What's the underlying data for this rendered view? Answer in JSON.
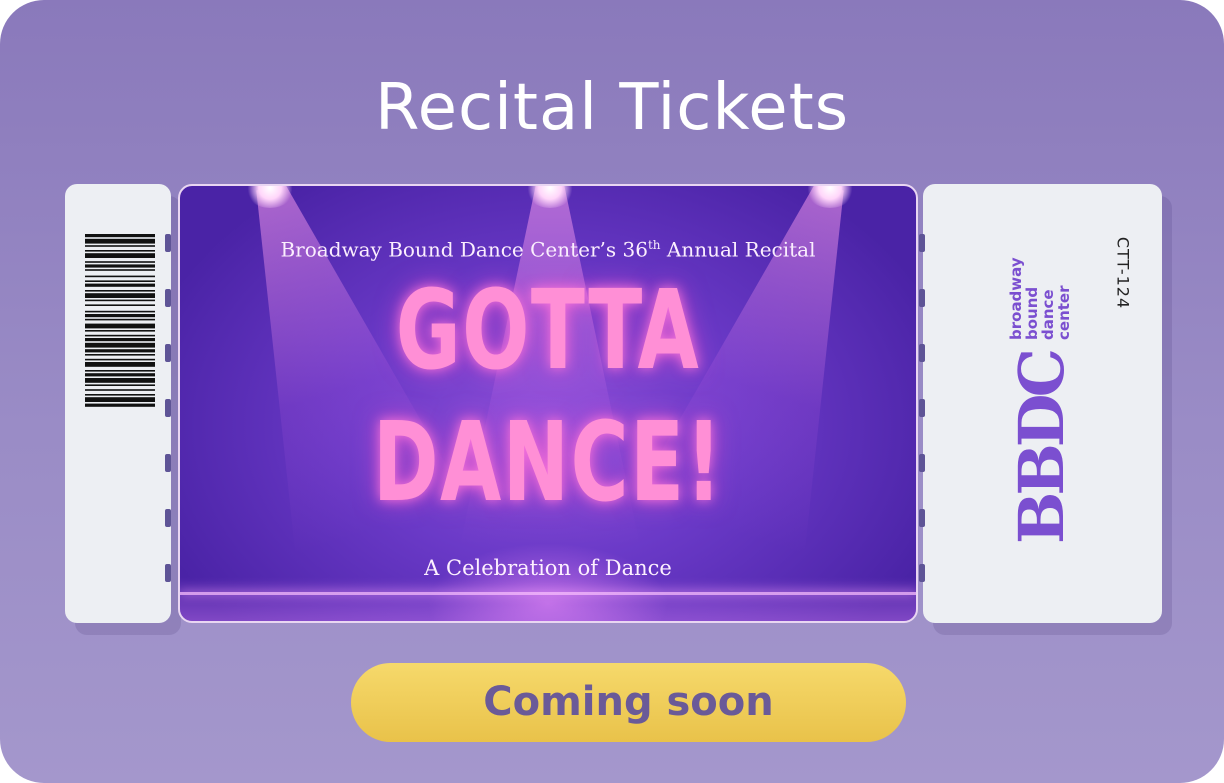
{
  "page": {
    "title": "Recital Tickets"
  },
  "ticket": {
    "subtitle_prefix": "Broadway Bound Dance Center’s 36",
    "subtitle_sup": "th",
    "subtitle_suffix": " Annual Recital",
    "headline_line1": "GOTTA",
    "headline_line2": "DANCE!",
    "tagline": "A Celebration of Dance",
    "ticket_code": "CTT-124",
    "logo_letters": "BBDC",
    "logo_wordmark": [
      "broadway",
      "bound",
      "dance",
      "center"
    ]
  },
  "actions": {
    "coming_soon_label": "Coming soon"
  },
  "colors": {
    "background": "#8a79bb",
    "headline": "#ff8fd6",
    "button": "#f0cc55",
    "button_text": "#6a5a98",
    "logo": "#7b4fd0"
  },
  "icons": {
    "barcode": "barcode-icon",
    "logo": "bbdc-logo"
  }
}
